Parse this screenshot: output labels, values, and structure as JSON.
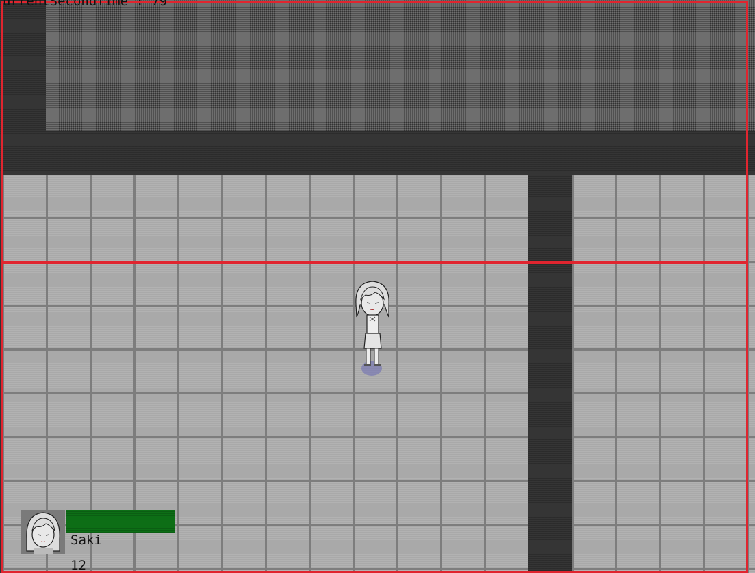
{
  "debug": {
    "text": "urrentSecondTime : 79"
  },
  "hud": {
    "portrait_icon": "girl-portrait-icon",
    "name": "Saki",
    "level": "12",
    "hp_color": "#0d6e16",
    "hp_fraction": 1.0
  },
  "player": {
    "icon": "girl-character-sprite",
    "shadow_color": "#6a6ab4"
  },
  "colors": {
    "zone_border": "#e0252f",
    "floor": "#a9a9a9",
    "wall": "#353535"
  }
}
